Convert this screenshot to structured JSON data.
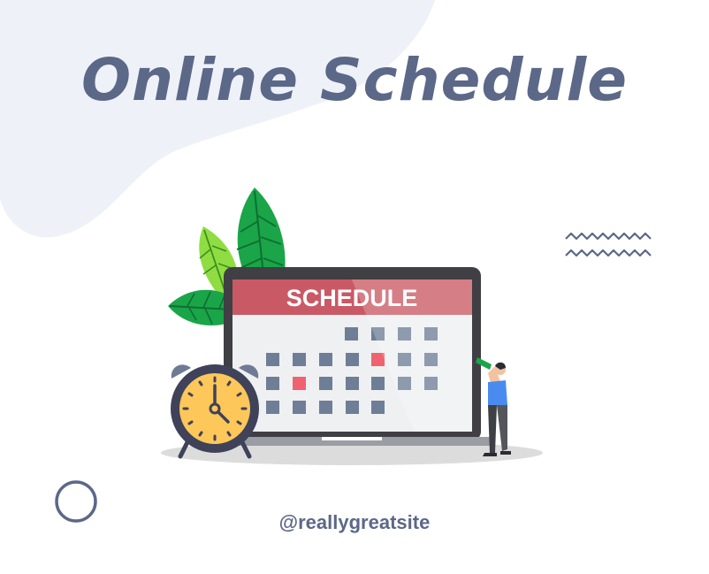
{
  "title": "Online Schedule",
  "calendar": {
    "header_label": "SCHEDULE"
  },
  "footer": {
    "handle": "@reallygreatsite"
  },
  "colors": {
    "blob": "#eef2f8",
    "text_primary": "#5c6888",
    "calendar_header": "#c95a65",
    "calendar_cell": "#6f7e97",
    "calendar_cell_light": "#a9b3c4",
    "calendar_cell_highlight": "#f06270",
    "clock_face": "#fdc75a",
    "leaf_dark": "#1aa548",
    "leaf_light": "#8fdd42",
    "person_shirt": "#4a8bf0"
  },
  "icons": [
    "alarm-clock-icon",
    "calendar-icon",
    "laptop-icon",
    "leaf-icon",
    "zigzag-decoration",
    "circle-decoration",
    "person-with-telescope"
  ]
}
